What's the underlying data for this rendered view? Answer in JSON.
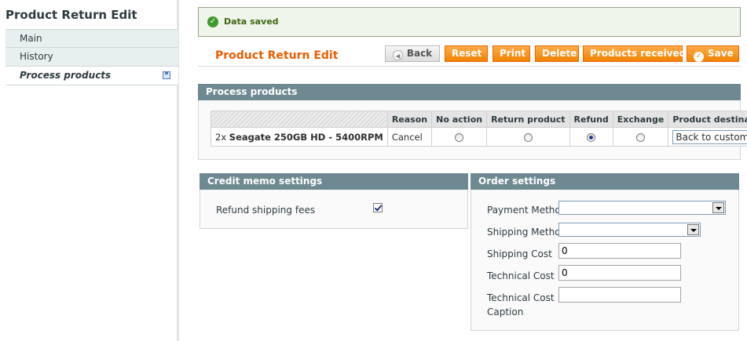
{
  "sidebar": {
    "title": "Product Return Edit",
    "tabs": [
      {
        "label": "Main"
      },
      {
        "label": "History"
      },
      {
        "label": "Process products"
      }
    ]
  },
  "message": {
    "text": "Data saved"
  },
  "header": {
    "title": "Product Return Edit",
    "buttons": {
      "back": "Back",
      "reset": "Reset",
      "print": "Print",
      "delete": "Delete",
      "products_received": "Products received",
      "save": "Save"
    }
  },
  "process_products": {
    "title": "Process products",
    "columns": [
      "",
      "Reason",
      "No action",
      "Return product",
      "Refund",
      "Exchange",
      "Product destination"
    ],
    "rows": [
      {
        "qty": "2x",
        "product": "Seagate 250GB HD - 5400RPM",
        "reason": "Cancel",
        "selected_action": "Refund",
        "destination": "Back to customer"
      }
    ]
  },
  "credit_memo": {
    "title": "Credit memo settings",
    "refund_shipping_label": "Refund shipping fees",
    "refund_shipping_checked": true
  },
  "order_settings": {
    "title": "Order settings",
    "payment_method_label": "Payment Method",
    "payment_method_value": "",
    "shipping_method_label": "Shipping Method",
    "shipping_method_value": "",
    "shipping_cost_label": "Shipping Cost",
    "shipping_cost_value": "0",
    "technical_cost_label": "Technical Cost",
    "technical_cost_value": "0",
    "technical_cost_caption_label_line1": "Technical Cost",
    "technical_cost_caption_label_line2": "Caption",
    "technical_cost_caption_value": ""
  },
  "colors": {
    "accent": "#eb5e00",
    "button": "#f18200",
    "section_header": "#6f8992",
    "success": "#3d9a2e"
  }
}
